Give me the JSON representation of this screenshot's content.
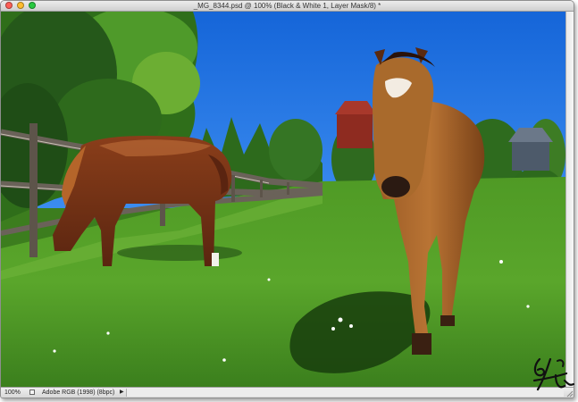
{
  "window": {
    "title": "_MG_8344.psd @ 100% (Black & White 1, Layer Mask/8) *"
  },
  "status": {
    "zoom": "100%",
    "document_info": "Adobe RGB (1998) (8bpc)"
  },
  "colors": {
    "close": "#ff5f57",
    "minimize": "#ffbd2e",
    "zoom": "#28c940",
    "sky": "#1c6fdf",
    "grass": "#3f8f22",
    "horse": "#8a4a1e"
  },
  "icons": {
    "close": "close-icon",
    "minimize": "minimize-icon",
    "maximize": "maximize-icon",
    "status_menu": "triangle-right-icon",
    "resize": "resize-grip-icon"
  }
}
